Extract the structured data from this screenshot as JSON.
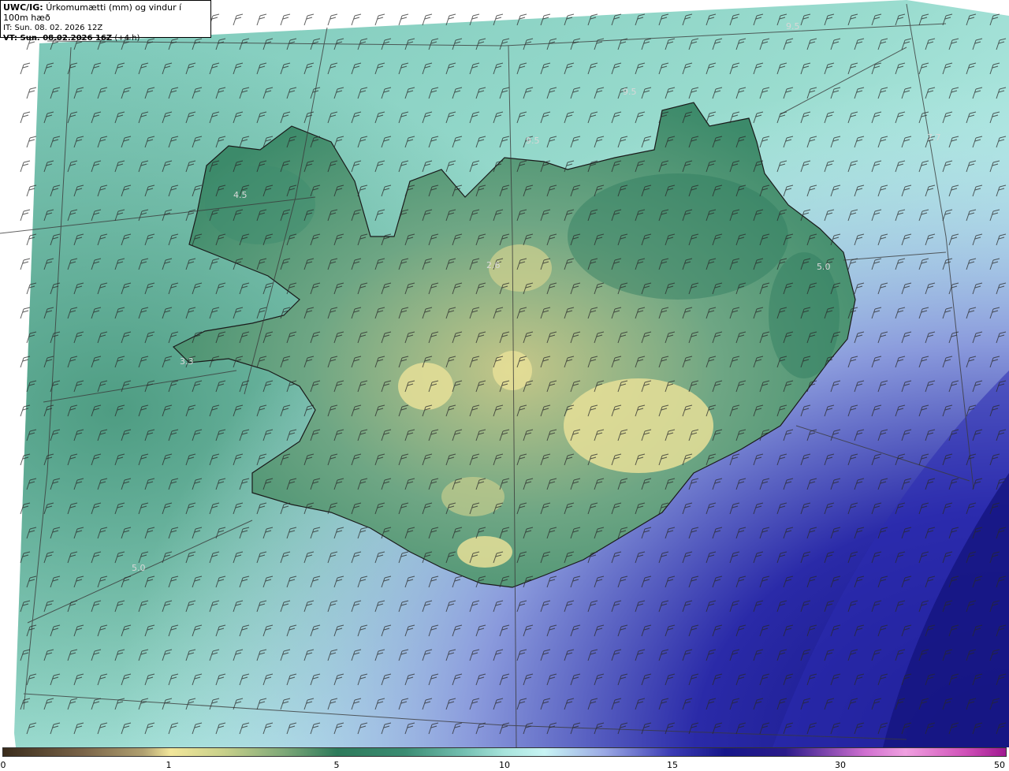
{
  "header": {
    "model": "UWC/IG:",
    "title": "Úrkomumætti (mm) og vindur í 100m hæð",
    "init_time": "IT: Sun. 08. 02. 2026 12Z",
    "valid_time_label": "VT: Sun. 08.02.2026 16Z",
    "valid_offset": "(+4 h)"
  },
  "colors": {
    "low_brown": "#5a4630",
    "yellow": "#f2e69a",
    "dark_green": "#2d7a5a",
    "teal": "#8ed8cc",
    "light_cyan": "#c8f4f4",
    "navy": "#16168a",
    "magenta": "#a01890"
  },
  "map_labels": [
    {
      "text": "9.5"
    },
    {
      "text": "9.5"
    },
    {
      "text": "9.5"
    },
    {
      "text": "7.7"
    },
    {
      "text": "4.5"
    },
    {
      "text": "2.6"
    },
    {
      "text": "5.0"
    },
    {
      "text": "3.3"
    },
    {
      "text": "5.0"
    }
  ],
  "colorbar": {
    "ticks": [
      "0",
      "1",
      "5",
      "10",
      "15",
      "30",
      "50"
    ]
  }
}
